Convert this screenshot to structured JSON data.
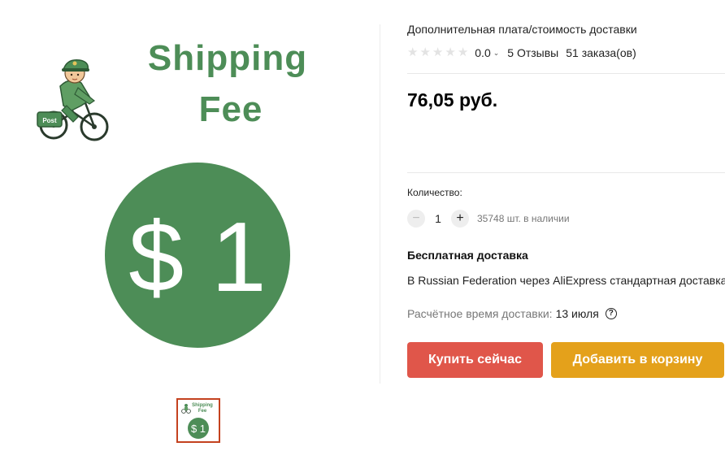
{
  "gallery": {
    "main_image": {
      "headline_line1": "Shipping",
      "headline_line2": "Fee",
      "badge_text": "$ 1",
      "bag_text": "Post"
    },
    "thumbnail": {
      "headline_line1": "Shipping",
      "headline_line2": "Fee",
      "badge_text": "$ 1"
    }
  },
  "product": {
    "title": "Дополнительная плата/стоимость доставки",
    "rating": {
      "stars_filled": 0,
      "stars_total": 5,
      "value": "0.0",
      "reviews": "5 Отзывы",
      "orders": "51 заказа(ов)"
    },
    "price": "76,05 руб.",
    "quantity": {
      "label": "Количество:",
      "value": "1",
      "minus_icon": "−",
      "plus_icon": "+",
      "stock": "35748 шт. в наличии"
    },
    "shipping": {
      "title": "Бесплатная доставка",
      "description": "В Russian Federation через AliExpress стандартная доставка",
      "time_label": "Расчётное время доставки:",
      "time_value": "13 июля",
      "help_icon": "?"
    },
    "buttons": {
      "buy_now": "Купить сейчас",
      "add_to_cart": "Добавить в корзину"
    }
  },
  "colors": {
    "green": "#4d8d57",
    "buy_button": "#e0564a",
    "cart_button": "#e4a11b",
    "thumb_border": "#c4421f"
  }
}
